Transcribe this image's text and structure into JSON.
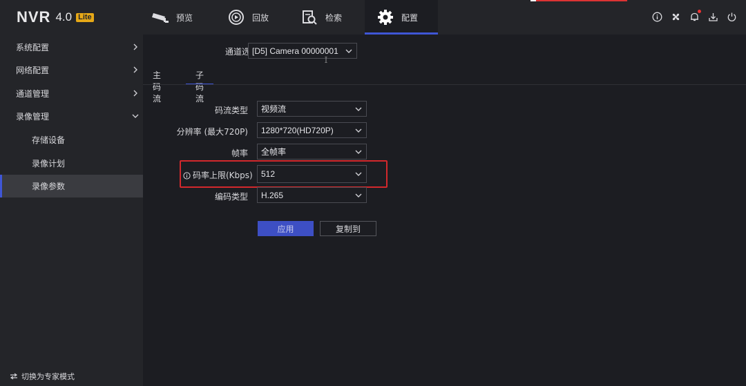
{
  "app": {
    "logo_text": "NVR",
    "logo_version": "4.0",
    "logo_edition": "Lite"
  },
  "nav": {
    "tabs": [
      {
        "label": "预览",
        "icon": "camera-icon"
      },
      {
        "label": "回放",
        "icon": "playback-icon"
      },
      {
        "label": "检索",
        "icon": "search-file-icon"
      },
      {
        "label": "配置",
        "icon": "gear-icon",
        "active": true
      }
    ],
    "tools": [
      "info-icon",
      "fan-icon",
      "bell-icon",
      "download-icon",
      "power-icon"
    ]
  },
  "sidebar": {
    "items": [
      {
        "label": "系统配置",
        "type": "group"
      },
      {
        "label": "网络配置",
        "type": "group"
      },
      {
        "label": "通道管理",
        "type": "group"
      },
      {
        "label": "录像管理",
        "type": "group-expanded"
      },
      {
        "label": "存储设备",
        "type": "sub"
      },
      {
        "label": "录像计划",
        "type": "sub"
      },
      {
        "label": "录像参数",
        "type": "sub",
        "active": true
      }
    ],
    "expert_mode_label": "切换为专家模式"
  },
  "main": {
    "channel_label": "通道选择",
    "channel_value": "[D5] Camera 00000001",
    "tabs": [
      {
        "label": "主码流"
      },
      {
        "label": "子码流",
        "active": true
      }
    ],
    "fields": [
      {
        "label": "码流类型",
        "value": "视频流"
      },
      {
        "label": "分辨率 (最大720P)",
        "value": "1280*720(HD720P)"
      },
      {
        "label": "帧率",
        "value": "全帧率"
      },
      {
        "label": "码率上限(Kbps)",
        "value": "512",
        "highlighted": true
      },
      {
        "label": "编码类型",
        "value": "H.265"
      }
    ],
    "apply_label": "应用",
    "copy_label": "复制到"
  },
  "colors": {
    "accent": "#3f56d6",
    "highlight_border": "#d4282c",
    "notification_dot": "#ee3333",
    "lite_badge": "#e6a817"
  }
}
